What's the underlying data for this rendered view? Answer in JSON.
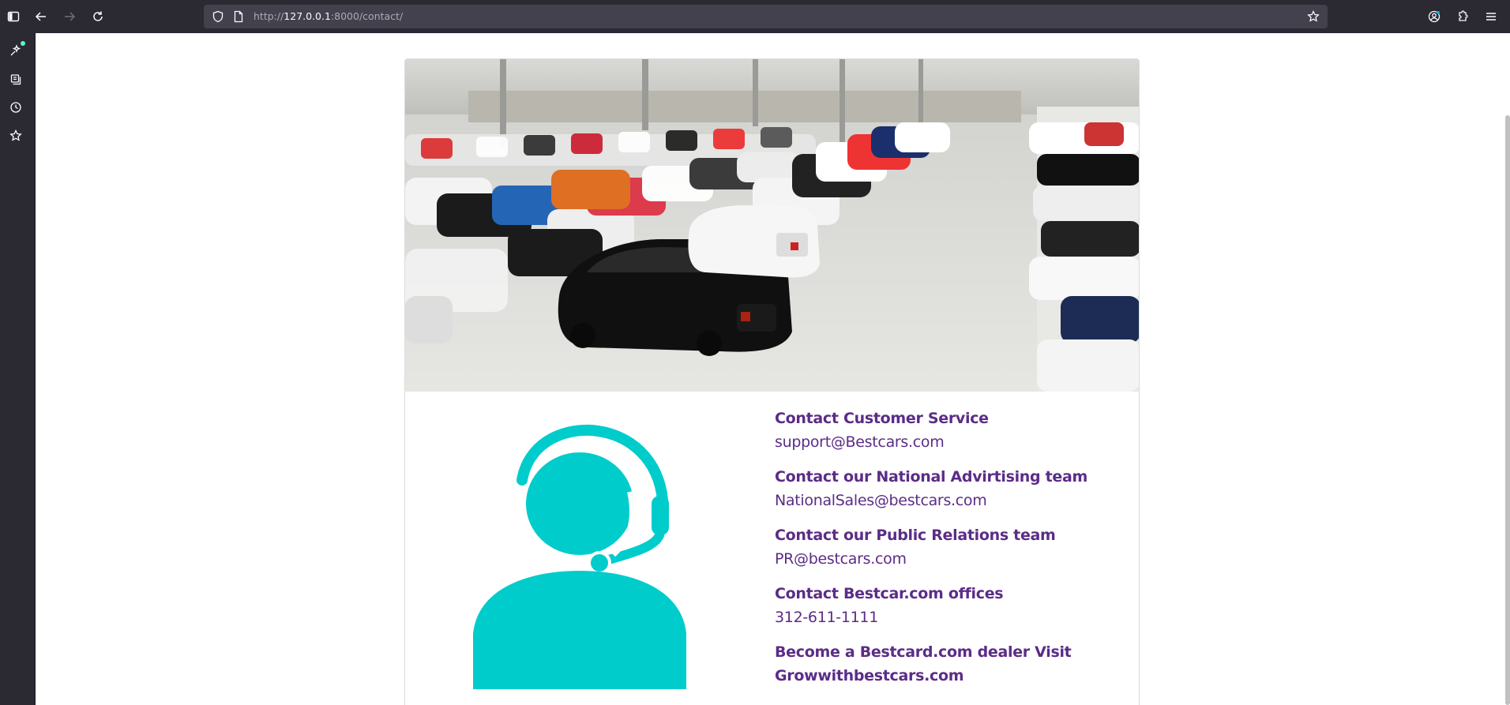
{
  "browser": {
    "url_scheme": "http://",
    "url_host": "127.0.0.1",
    "url_rest": ":8000/contact/"
  },
  "contact": {
    "items": [
      {
        "title": "Contact Customer Service",
        "value": "support@Bestcars.com"
      },
      {
        "title": "Contact our National Advirtising team",
        "value": "NationalSales@bestcars.com"
      },
      {
        "title": "Contact our Public Relations team",
        "value": "PR@bestcars.com"
      },
      {
        "title": "Contact Bestcar.com offices",
        "value": "312-611-1111"
      },
      {
        "title": "Become a Bestcard.com dealer Visit",
        "value": "Growwithbestcars.com"
      }
    ]
  },
  "colors": {
    "accent_text": "#5b2c87",
    "agent_icon": "#00cccc",
    "chrome_bg": "#2b2a33"
  },
  "icons": {
    "sidebar": [
      "sidebar-toggle-icon",
      "ai-chat-icon",
      "bookmarks-icon",
      "history-icon",
      "star-icon"
    ],
    "toolbar": [
      "back-icon",
      "forward-icon",
      "reload-icon",
      "shield-icon",
      "page-icon",
      "bookmark-star-icon",
      "account-icon",
      "extensions-icon",
      "menu-icon"
    ]
  }
}
